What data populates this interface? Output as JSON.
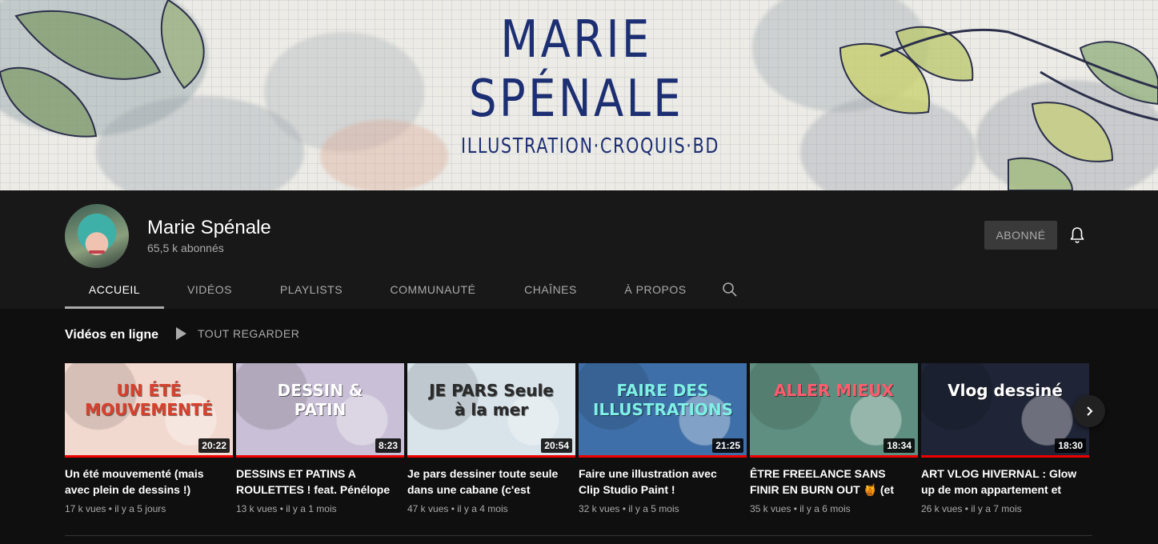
{
  "banner": {
    "line1": "MARIE",
    "line2": "SPÉNALE",
    "subtitle": "ILLUSTRATION·CROQUIS·BD"
  },
  "channel": {
    "name": "Marie Spénale",
    "subscribers": "65,5 k abonnés",
    "subscribe_label": "ABONNÉ"
  },
  "tabs": [
    {
      "label": "ACCUEIL",
      "active": true
    },
    {
      "label": "VIDÉOS"
    },
    {
      "label": "PLAYLISTS"
    },
    {
      "label": "COMMUNAUTÉ"
    },
    {
      "label": "CHAÎNES"
    },
    {
      "label": "À PROPOS"
    }
  ],
  "section": {
    "title": "Vidéos en ligne",
    "play_all": "TOUT REGARDER"
  },
  "videos": [
    {
      "title": "Un été mouvementé (mais avec plein de dessins !)",
      "views": "17 k vues",
      "age": "il y a 5 jours",
      "duration": "20:22",
      "thumb_text": "UN ÉTÉ MOUVEMENTÉ",
      "bg": "#f2d9cf",
      "fg": "#d8402c"
    },
    {
      "title": "DESSINS ET PATINS A ROULETTES ! feat. Pénélope Bagieu",
      "views": "13 k vues",
      "age": "il y a 1 mois",
      "duration": "8:23",
      "thumb_text": "DESSIN & PATIN",
      "bg": "#c9bfd6",
      "fg": "#ffffff"
    },
    {
      "title": "Je pars dessiner toute seule dans une cabane (c'est génial)",
      "views": "47 k vues",
      "age": "il y a 4 mois",
      "duration": "20:54",
      "thumb_text": "JE PARS Seule à la mer",
      "bg": "#d8e4ea",
      "fg": "#2a2a2a"
    },
    {
      "title": "Faire une illustration avec Clip Studio Paint !",
      "views": "32 k vues",
      "age": "il y a 5 mois",
      "duration": "21:25",
      "thumb_text": "FAIRE DES ILLUSTRATIONS",
      "bg": "#3f6fa8",
      "fg": "#7ff0e6"
    },
    {
      "title": "ÊTRE FREELANCE SANS FINIR EN BURN OUT 🍯 (et autres conseils)",
      "views": "35 k vues",
      "age": "il y a 6 mois",
      "duration": "18:34",
      "thumb_text": "ALLER MIEUX",
      "bg": "#5e8f80",
      "fg": "#ff5c6e"
    },
    {
      "title": "ART VLOG HIVERNAL : Glow up de mon appartement et dessins",
      "views": "26 k vues",
      "age": "il y a 7 mois",
      "duration": "18:30",
      "thumb_text": "Vlog dessiné",
      "bg": "#1f2436",
      "fg": "#ffffff"
    }
  ]
}
